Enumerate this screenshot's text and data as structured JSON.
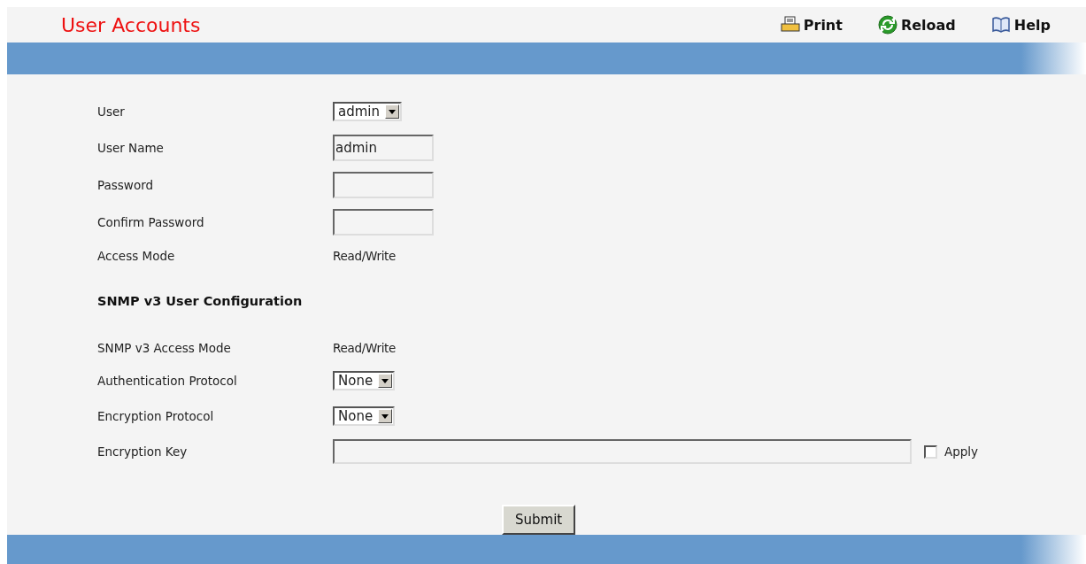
{
  "page": {
    "title": "User Accounts"
  },
  "toolbar": [
    {
      "kind": "print",
      "label": "Print"
    },
    {
      "kind": "reload",
      "label": "Reload"
    },
    {
      "kind": "help",
      "label": "Help"
    }
  ],
  "user_rows": [
    {
      "kind": "select",
      "label": "User",
      "value": "admin"
    },
    {
      "kind": "text",
      "label": "User Name",
      "value": "admin"
    },
    {
      "kind": "text",
      "label": "Password"
    },
    {
      "kind": "text",
      "label": "Confirm Password"
    },
    {
      "kind": "static",
      "label": "Access Mode",
      "value": "Read/Write"
    }
  ],
  "snmp_section": {
    "heading": "SNMP v3 User Configuration",
    "rows": [
      {
        "kind": "static",
        "label": "SNMP v3 Access Mode",
        "value": "Read/Write"
      },
      {
        "kind": "select",
        "label": "Authentication Protocol",
        "value": "None"
      },
      {
        "kind": "select",
        "label": "Encryption Protocol",
        "value": "None"
      },
      {
        "kind": "key",
        "label": "Encryption Key",
        "checkbox": {
          "label": "Apply",
          "checked": false
        }
      }
    ]
  },
  "submit": "Submit"
}
